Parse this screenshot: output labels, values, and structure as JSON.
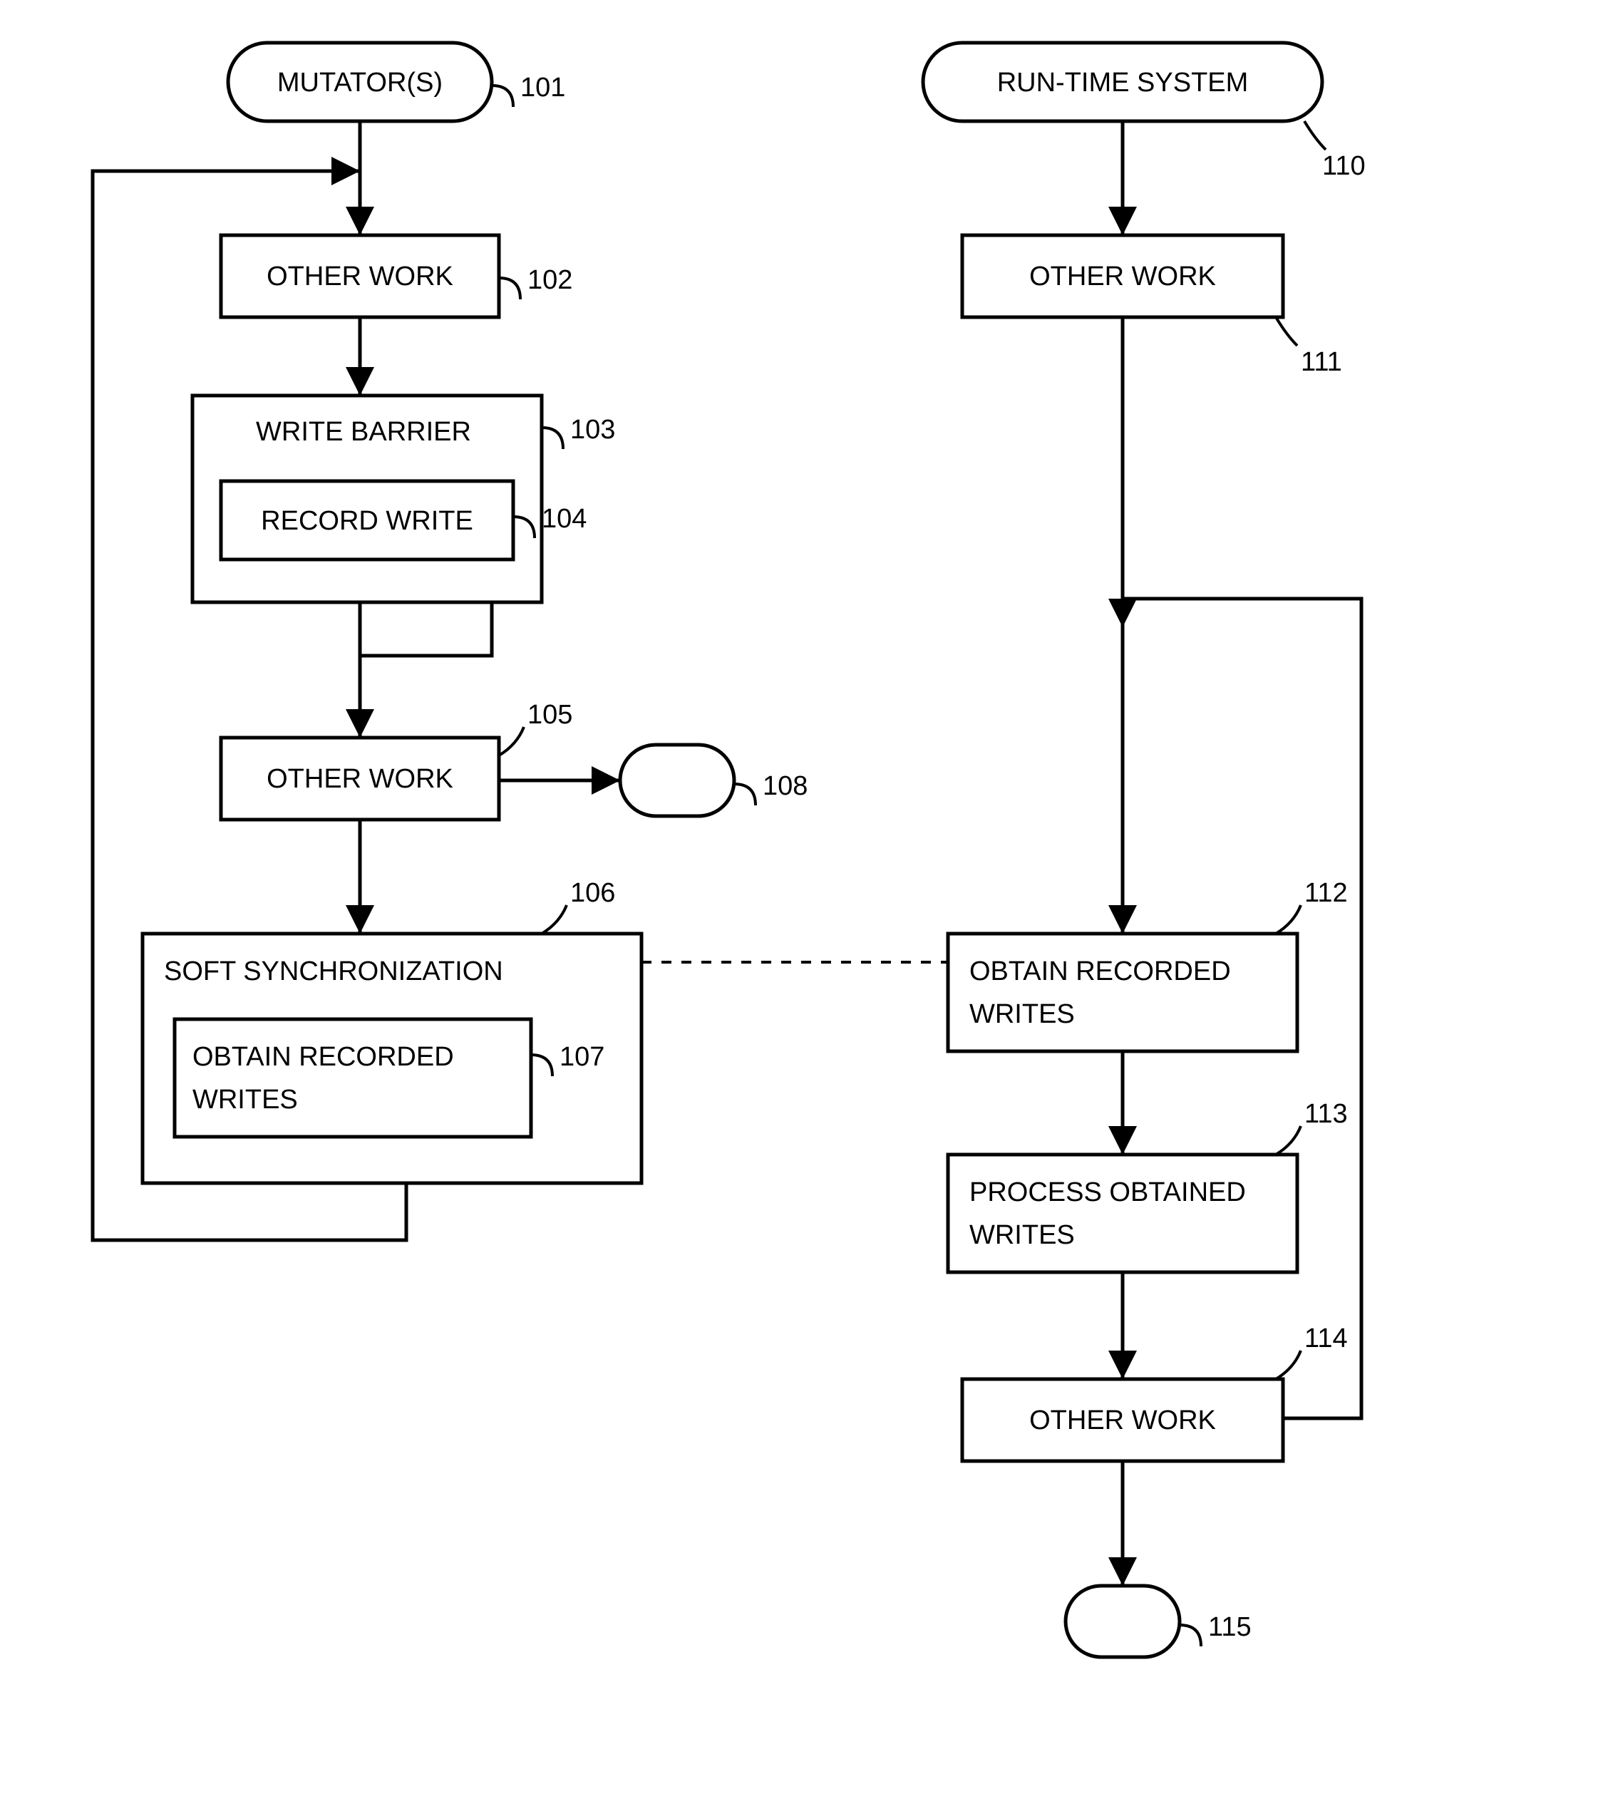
{
  "nodes": {
    "n101": {
      "label": "MUTATOR(S)",
      "num": "101"
    },
    "n102": {
      "label": "OTHER WORK",
      "num": "102"
    },
    "n103": {
      "label": "WRITE BARRIER",
      "num": "103"
    },
    "n104": {
      "label": "RECORD WRITE",
      "num": "104"
    },
    "n105": {
      "label": "OTHER WORK",
      "num": "105"
    },
    "n106": {
      "label": "SOFT SYNCHRONIZATION",
      "num": "106"
    },
    "n107_l1": {
      "label": "OBTAIN RECORDED"
    },
    "n107_l2": {
      "label": "WRITES"
    },
    "n107": {
      "num": "107"
    },
    "n108": {
      "num": "108"
    },
    "n110": {
      "label": "RUN-TIME SYSTEM",
      "num": "110"
    },
    "n111": {
      "label": "OTHER WORK",
      "num": "111"
    },
    "n112_l1": {
      "label": "OBTAIN RECORDED"
    },
    "n112_l2": {
      "label": "WRITES"
    },
    "n112": {
      "num": "112"
    },
    "n113_l1": {
      "label": "PROCESS OBTAINED"
    },
    "n113_l2": {
      "label": "WRITES"
    },
    "n113": {
      "num": "113"
    },
    "n114": {
      "label": "OTHER WORK",
      "num": "114"
    },
    "n115": {
      "num": "115"
    }
  }
}
